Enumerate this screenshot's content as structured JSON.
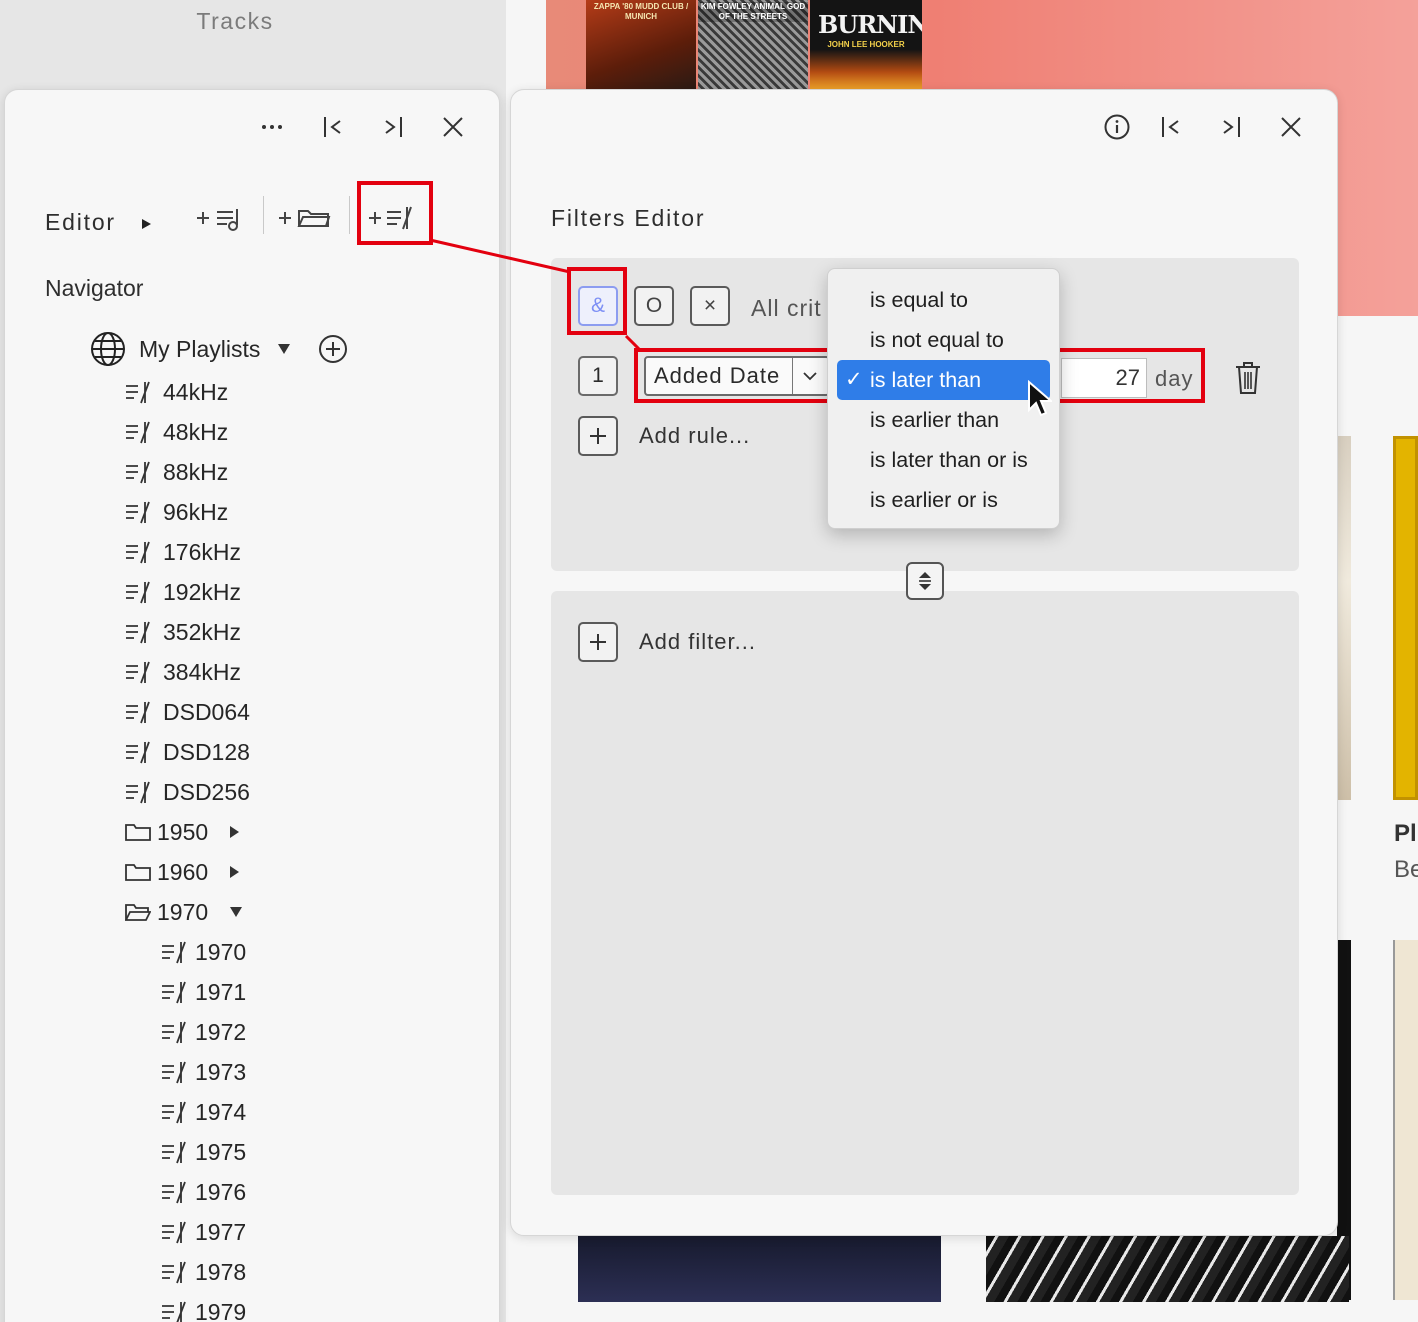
{
  "background": {
    "tracks_label": "Tracks",
    "album_1_caption": "ZAPPA '80 MUDD CLUB / MUNICH",
    "album_2_caption": "KIM FOWLEY ANIMAL GOD OF THE STREETS",
    "album_3_title": "BURNIN'",
    "album_3_caption": "JOHN LEE HOOKER",
    "side_text_1": "Pl",
    "side_text_2": "Be"
  },
  "navigator_panel": {
    "editor_label": "Editor",
    "navigator_title": "Navigator",
    "root": {
      "label": "My Playlists"
    },
    "playlists": [
      "44kHz",
      "48kHz",
      "88kHz",
      "96kHz",
      "176kHz",
      "192kHz",
      "352kHz",
      "384kHz",
      "DSD064",
      "DSD128",
      "DSD256"
    ],
    "folders": [
      {
        "label": "1950",
        "expanded": false
      },
      {
        "label": "1960",
        "expanded": false
      },
      {
        "label": "1970",
        "expanded": true
      }
    ],
    "folder_1970_children": [
      "1970",
      "1971",
      "1972",
      "1973",
      "1974",
      "1975",
      "1976",
      "1977",
      "1978",
      "1979"
    ]
  },
  "filters_panel": {
    "title": "Filters Editor",
    "match_modes": [
      "&",
      "O",
      "×"
    ],
    "criteria_text": "All crit",
    "rule": {
      "number": "1",
      "field": "Added Date",
      "value": "27",
      "unit": "day"
    },
    "add_rule_label": "Add rule...",
    "add_filter_label": "Add filter..."
  },
  "operator_dropdown": {
    "selected": "is later than",
    "options": [
      "is equal to",
      "is not equal to",
      "is later than",
      "is earlier than",
      "is later than or is",
      "is earlier or is"
    ]
  },
  "colors": {
    "highlight_red": "#e3000f",
    "selection_blue": "#2f7de8",
    "mode_selected": "#7d8ff5"
  }
}
